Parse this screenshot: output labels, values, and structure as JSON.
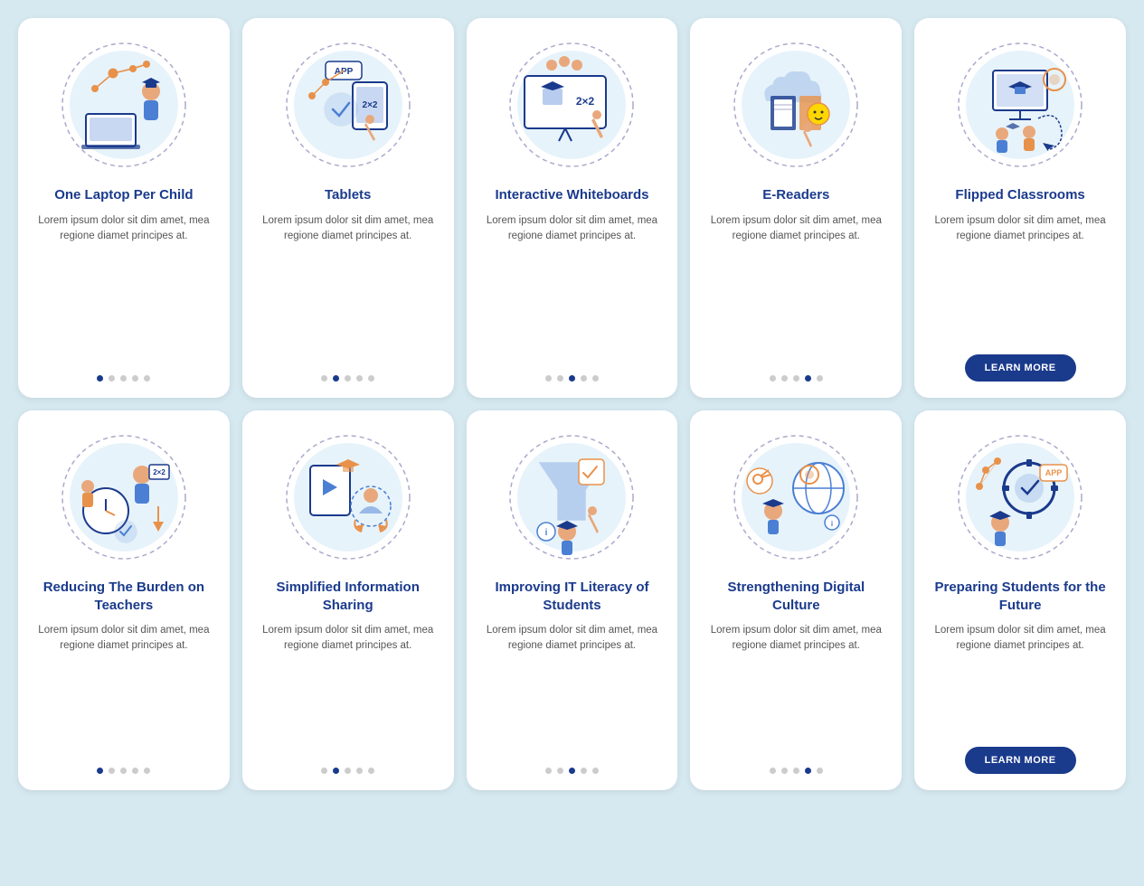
{
  "cards": [
    {
      "id": "one-laptop",
      "title": "One Laptop Per Child",
      "body": "Lorem ipsum dolor sit dim amet, mea regione diamet principes at.",
      "dots": 1,
      "hasButton": false,
      "illustration": "laptop"
    },
    {
      "id": "tablets",
      "title": "Tablets",
      "body": "Lorem ipsum dolor sit dim amet, mea regione diamet principes at.",
      "dots": 2,
      "hasButton": false,
      "illustration": "tablet"
    },
    {
      "id": "interactive-whiteboards",
      "title": "Interactive Whiteboards",
      "body": "Lorem ipsum dolor sit dim amet, mea regione diamet principes at.",
      "dots": 3,
      "hasButton": false,
      "illustration": "whiteboard"
    },
    {
      "id": "e-readers",
      "title": "E-Readers",
      "body": "Lorem ipsum dolor sit dim amet, mea regione diamet principes at.",
      "dots": 4,
      "hasButton": false,
      "illustration": "ereader"
    },
    {
      "id": "flipped-classrooms",
      "title": "Flipped Classrooms",
      "body": "Lorem ipsum dolor sit dim amet, mea regione diamet principes at.",
      "dots": 5,
      "hasButton": true,
      "illustration": "flipped"
    },
    {
      "id": "reducing-burden",
      "title": "Reducing The Burden on Teachers",
      "body": "Lorem ipsum dolor sit dim amet, mea regione diamet principes at.",
      "dots": 1,
      "hasButton": false,
      "illustration": "burden"
    },
    {
      "id": "simplified-sharing",
      "title": "Simplified Information Sharing",
      "body": "Lorem ipsum dolor sit dim amet, mea regione diamet principes at.",
      "dots": 2,
      "hasButton": false,
      "illustration": "sharing"
    },
    {
      "id": "it-literacy",
      "title": "Improving IT Literacy of Students",
      "body": "Lorem ipsum dolor sit dim amet, mea regione diamet principes at.",
      "dots": 3,
      "hasButton": false,
      "illustration": "literacy"
    },
    {
      "id": "digital-culture",
      "title": "Strengthening Digital Culture",
      "body": "Lorem ipsum dolor sit dim amet, mea regione diamet principes at.",
      "dots": 4,
      "hasButton": false,
      "illustration": "digital"
    },
    {
      "id": "future-students",
      "title": "Preparing Students for the Future",
      "body": "Lorem ipsum dolor sit dim amet, mea regione diamet principes at.",
      "dots": 5,
      "hasButton": true,
      "illustration": "future"
    }
  ],
  "learnMore": "LEARN MORE"
}
